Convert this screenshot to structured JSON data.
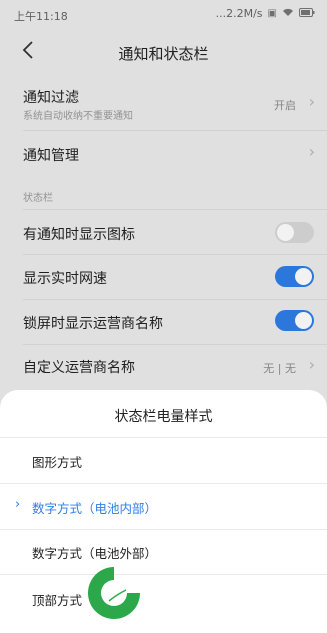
{
  "status_bar": {
    "time": "上午11:18",
    "network_speed": "...2.2M/s",
    "icons": [
      "sim-icon",
      "wifi-icon",
      "battery-icon"
    ]
  },
  "nav": {
    "title": "通知和状态栏"
  },
  "settings": {
    "notification_filter": {
      "title": "通知过滤",
      "subtitle": "系统自动收纳不重要通知",
      "value": "开启"
    },
    "notification_management": {
      "title": "通知管理"
    },
    "section_status_bar": "状态栏",
    "show_notification_icon": {
      "title": "有通知时显示图标",
      "enabled": false
    },
    "show_network_speed": {
      "title": "显示实时网速",
      "enabled": true
    },
    "show_carrier_on_lock": {
      "title": "锁屏时显示运营商名称",
      "enabled": true
    },
    "custom_carrier_name": {
      "title": "自定义运营商名称",
      "value": "无 | 无"
    }
  },
  "sheet": {
    "title": "状态栏电量样式",
    "options": [
      {
        "label": "图形方式",
        "selected": false
      },
      {
        "label": "数字方式（电池内部）",
        "selected": true
      },
      {
        "label": "数字方式（电池外部）",
        "selected": false
      },
      {
        "label": "顶部方式",
        "selected": false
      }
    ],
    "selected_mark": "›"
  },
  "colors": {
    "accent": "#2f7ee7",
    "logo_green": "#2ca84a"
  }
}
